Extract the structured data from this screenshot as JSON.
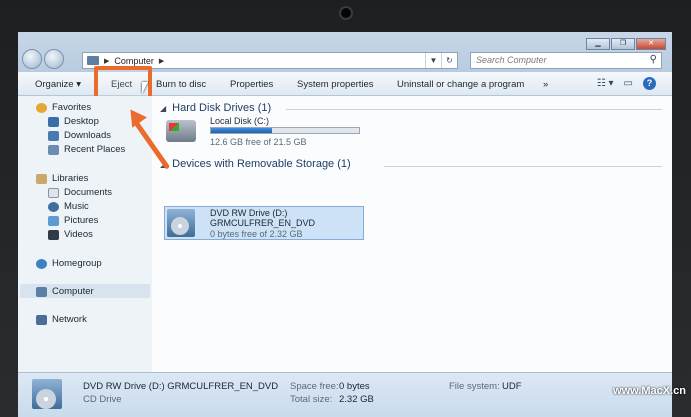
{
  "window": {
    "breadcrumb_root": "Computer",
    "search_placeholder": "Search Computer"
  },
  "toolbar": {
    "organize": "Organize",
    "eject": "Eject",
    "burn": "Burn to disc",
    "properties": "Properties",
    "system_properties": "System properties",
    "uninstall": "Uninstall or change a program",
    "more": "»"
  },
  "nav": {
    "favorites": "Favorites",
    "desktop": "Desktop",
    "downloads": "Downloads",
    "recent": "Recent Places",
    "libraries": "Libraries",
    "documents": "Documents",
    "music": "Music",
    "pictures": "Pictures",
    "videos": "Videos",
    "homegroup": "Homegroup",
    "computer": "Computer",
    "network": "Network"
  },
  "content": {
    "hdd_group": "Hard Disk Drives (1)",
    "local_disk": {
      "name": "Local Disk (C:)",
      "free_text": "12.6 GB free of 21.5 GB",
      "used_fraction": 0.41
    },
    "removable_group": "Devices with Removable Storage (1)",
    "dvd": {
      "name": "DVD RW Drive (D:)",
      "label": "GRMCULFRER_EN_DVD",
      "free_text": "0 bytes free of 2.32 GB",
      "used_fraction": 1.0
    }
  },
  "details": {
    "title": "DVD RW Drive (D:) GRMCULFRER_EN_DVD",
    "type": "CD Drive",
    "space_free_label": "Space free:",
    "space_free": "0 bytes",
    "total_size_label": "Total size:",
    "total_size": "2.32 GB",
    "filesystem_label": "File system:",
    "filesystem": "UDF"
  },
  "watermark": "www.MacX.cn"
}
